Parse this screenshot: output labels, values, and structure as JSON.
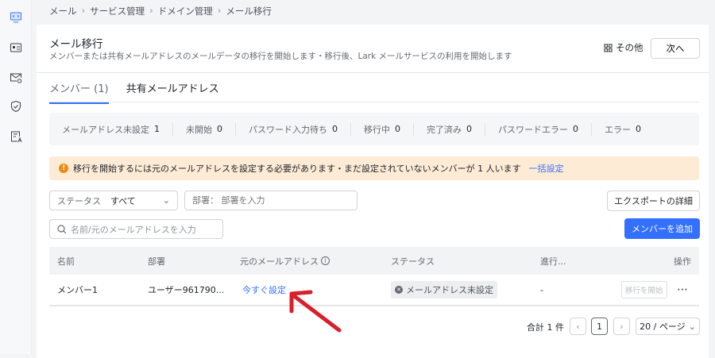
{
  "sidebar": {
    "icons": [
      "code-monitor-icon",
      "contact-card-icon",
      "mail-settings-icon",
      "shield-check-icon",
      "document-user-icon"
    ]
  },
  "breadcrumb": [
    "メール",
    "サービス管理",
    "ドメイン管理",
    "メール移行"
  ],
  "header": {
    "title": "メール移行",
    "description": "メンバーまたは共有メールアドレスのメールデータの移行を開始します・移行後、Lark メールサービスの利用を開始します",
    "more_label": "その他",
    "next_label": "次へ"
  },
  "tabs": [
    {
      "label": "メンバー (1)",
      "active": true
    },
    {
      "label": "共有メールアドレス",
      "active": false
    }
  ],
  "stats": [
    {
      "label": "メールアドレス未設定",
      "value": "1"
    },
    {
      "label": "未開始",
      "value": "0"
    },
    {
      "label": "パスワード入力待ち",
      "value": "0"
    },
    {
      "label": "移行中",
      "value": "0"
    },
    {
      "label": "完了済み",
      "value": "0"
    },
    {
      "label": "パスワードエラー",
      "value": "0"
    },
    {
      "label": "エラー",
      "value": "0"
    }
  ],
  "warning": {
    "text": "移行を開始するには元のメールアドレスを設定する必要があります・まだ設定されていないメンバーが 1 人います",
    "link": "一括設定"
  },
  "filters": {
    "status_label": "ステータス",
    "status_value": "すべて",
    "dept_placeholder": "部署： 部署を入力",
    "search_placeholder": "名前/元のメールアドレスを入力",
    "export_label": "エクスポートの詳細",
    "add_member_label": "メンバーを追加"
  },
  "table": {
    "columns": [
      "名前",
      "部署",
      "元のメールアドレス",
      "ステータス",
      "進行...",
      "操作"
    ],
    "rows": [
      {
        "name": "メンバー1",
        "dept": "ユーザー961790...",
        "source": "今すぐ設定",
        "status": "メールアドレス未設定",
        "progress": "-",
        "action": "移行を開始"
      }
    ]
  },
  "pagination": {
    "total": "合計 1 件",
    "page": "1",
    "page_size": "20 / ページ"
  },
  "colors": {
    "accent": "#3370ff",
    "warning_bg": "#fdebd5",
    "annotation": "#d81f2c"
  }
}
